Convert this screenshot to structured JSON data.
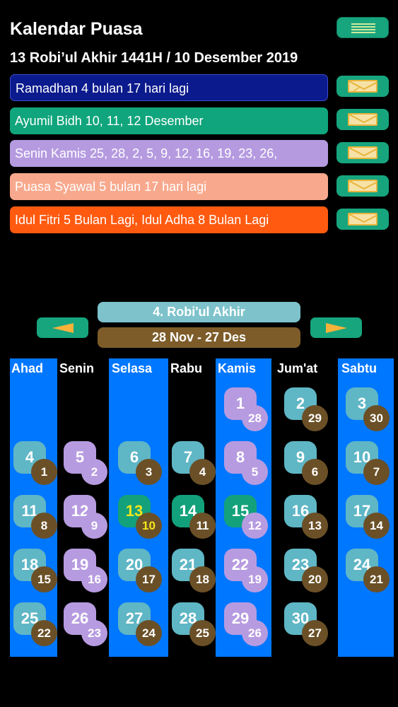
{
  "header": {
    "title": "Kalendar Puasa",
    "date": "13 Robi’ul Akhir 1441H / 10  Desember  2019"
  },
  "banners": [
    {
      "text": "Ramadhan 4 bulan 17 hari lagi",
      "color": "#0b1a8c"
    },
    {
      "text": "Ayumil Bidh 10, 11, 12 Desember",
      "color": "#10a57c"
    },
    {
      "text": "Senin Kamis  25, 28, 2, 5, 9, 12, 16, 19, 23, 26,",
      "color": "#b59ae0"
    },
    {
      "text": "Puasa Syawal  5 bulan 17 hari lagi",
      "color": "#f8a98d"
    },
    {
      "text": "Idul Fitri 5 Bulan Lagi, Idul Adha 8  Bulan Lagi",
      "color": "#ff5a10"
    }
  ],
  "nav": {
    "month_title": "4. Robi'ul Akhir",
    "range": "28 Nov - 27 Des"
  },
  "days": [
    "Ahad",
    "Senin",
    "Selasa",
    "Rabu",
    "Kamis",
    "Jum'at",
    "Sabtu"
  ],
  "colors": {
    "highlight_column": "#0077ff",
    "accent_green": "#17a57e",
    "today_text": "#f4e51c"
  },
  "weeks": [
    [
      null,
      null,
      null,
      null,
      {
        "h": "1",
        "g": "28"
      },
      {
        "h": "2",
        "g": "29"
      },
      {
        "h": "3",
        "g": "30"
      }
    ],
    [
      {
        "h": "4",
        "g": "1"
      },
      {
        "h": "5",
        "g": "2"
      },
      {
        "h": "6",
        "g": "3"
      },
      {
        "h": "7",
        "g": "4"
      },
      {
        "h": "8",
        "g": "5"
      },
      {
        "h": "9",
        "g": "6"
      },
      {
        "h": "10",
        "g": "7"
      }
    ],
    [
      {
        "h": "11",
        "g": "8"
      },
      {
        "h": "12",
        "g": "9"
      },
      {
        "h": "13",
        "g": "10"
      },
      {
        "h": "14",
        "g": "11"
      },
      {
        "h": "15",
        "g": "12"
      },
      {
        "h": "16",
        "g": "13"
      },
      {
        "h": "17",
        "g": "14"
      }
    ],
    [
      {
        "h": "18",
        "g": "15"
      },
      {
        "h": "19",
        "g": "16"
      },
      {
        "h": "20",
        "g": "17"
      },
      {
        "h": "21",
        "g": "18"
      },
      {
        "h": "22",
        "g": "19"
      },
      {
        "h": "23",
        "g": "20"
      },
      {
        "h": "24",
        "g": "21"
      }
    ],
    [
      {
        "h": "25",
        "g": "22"
      },
      {
        "h": "26",
        "g": "23"
      },
      {
        "h": "27",
        "g": "24"
      },
      {
        "h": "28",
        "g": "25"
      },
      {
        "h": "29",
        "g": "26"
      },
      {
        "h": "30",
        "g": "27"
      },
      null
    ]
  ]
}
